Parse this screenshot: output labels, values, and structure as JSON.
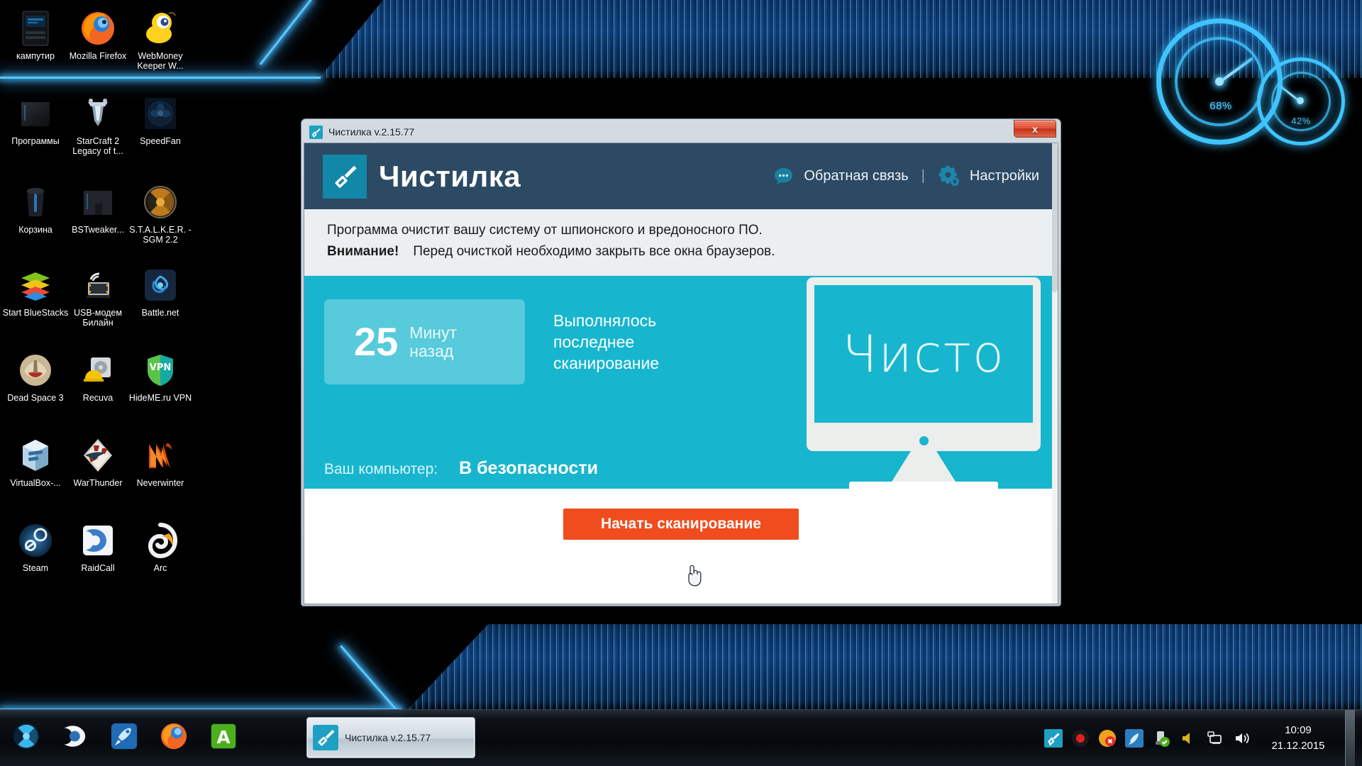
{
  "window": {
    "title": "Чистилка v.2.15.77",
    "close_label": "x",
    "close_icon": "close-icon"
  },
  "app": {
    "logo_icon": "brush-icon",
    "name": "Чистилка",
    "header": {
      "feedback_icon": "chat-bubble-icon",
      "feedback_label": "Обратная связь",
      "separator": "|",
      "settings_icon": "gear-icon",
      "settings_label": "Настройки"
    },
    "notice": {
      "line1": "Программа очистит вашу систему от шпионского и вредоносного ПО.",
      "warning_label": "Внимание!",
      "line2": "Перед очисткой необходимо закрыть все окна браузеров."
    },
    "status": {
      "minutes_value": "25",
      "minutes_unit_line1": "Минут",
      "minutes_unit_line2": "назад",
      "caption_line1": "Выполнялось",
      "caption_line2": "последнее",
      "caption_line3": "сканирование",
      "computer_label": "Ваш компьютер:",
      "computer_state": "В безопасности",
      "monitor_word": "Чисто"
    },
    "scan_button": "Начать сканирование",
    "colors": {
      "header_bg": "#2c4a63",
      "panel_cyan": "#17b6ce",
      "accent_orange": "#f04c1e",
      "logo_bg": "#1287a8",
      "notice_bg": "#eceff1"
    }
  },
  "desktop": {
    "icons": [
      {
        "label": "кампутир",
        "icon": "pc-case-icon"
      },
      {
        "label": "Mozilla Firefox",
        "icon": "firefox-icon"
      },
      {
        "label": "WebMoney Keeper W...",
        "icon": "webmoney-icon"
      },
      {
        "label": "Программы",
        "icon": "folder-icon"
      },
      {
        "label": "StarCraft 2 Legacy of t...",
        "icon": "starcraft2-icon"
      },
      {
        "label": "SpeedFan",
        "icon": "speedfan-icon"
      },
      {
        "label": "Корзина",
        "icon": "recycle-bin-icon"
      },
      {
        "label": "BSTweaker...",
        "icon": "folder-icon"
      },
      {
        "label": "S.T.A.L.K.E.R. - SGM 2.2",
        "icon": "radiation-icon"
      },
      {
        "label": "Start BlueStacks",
        "icon": "bluestacks-icon"
      },
      {
        "label": "USB-модем Билайн",
        "icon": "usb-modem-icon"
      },
      {
        "label": "Battle.net",
        "icon": "battlenet-icon"
      },
      {
        "label": "Dead Space 3",
        "icon": "deadspace3-icon"
      },
      {
        "label": "Recuva",
        "icon": "recuva-icon"
      },
      {
        "label": "HideME.ru VPN",
        "icon": "vpn-shield-icon"
      },
      {
        "label": "VirtualBox-...",
        "icon": "virtualbox-icon"
      },
      {
        "label": "WarThunder",
        "icon": "warthunder-icon"
      },
      {
        "label": "Neverwinter",
        "icon": "neverwinter-icon"
      },
      {
        "label": "Steam",
        "icon": "steam-icon"
      },
      {
        "label": "RaidCall",
        "icon": "raidcall-icon"
      },
      {
        "label": "Arc",
        "icon": "arc-icon"
      }
    ],
    "gauges": [
      {
        "value": "68%",
        "name": "cpu-gauge"
      },
      {
        "value": "42%",
        "name": "memory-gauge"
      }
    ]
  },
  "taskbar": {
    "quick_icons": [
      {
        "name": "radiation-icon"
      },
      {
        "name": "raidcall-icon"
      },
      {
        "name": "rocket-icon"
      },
      {
        "name": "firefox-icon"
      },
      {
        "name": "aimp-icon"
      }
    ],
    "active_task": {
      "icon": "brush-icon",
      "label": "Чистилка v.2.15.77"
    },
    "tray_icons": [
      {
        "name": "chistilka-tray-icon"
      },
      {
        "name": "record-tray-icon"
      },
      {
        "name": "error-tray-icon"
      },
      {
        "name": "rocket-tray-icon"
      },
      {
        "name": "update-check-tray-icon"
      },
      {
        "name": "speaker-mute-tray-icon"
      },
      {
        "name": "network-tray-icon"
      },
      {
        "name": "volume-tray-icon"
      }
    ],
    "clock": {
      "time": "10:09",
      "date": "21.12.2015"
    }
  }
}
